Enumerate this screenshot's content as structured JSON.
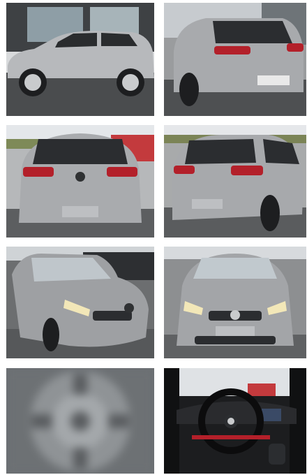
{
  "gallery": {
    "photos": [
      {
        "view": "side-left",
        "colors": {
          "body": "#b7b9bc",
          "bg": "#5c5f61",
          "ground": "#4a4c4e"
        }
      },
      {
        "view": "rear-three-quarter",
        "colors": {
          "body": "#a8aaad",
          "bg": "#8b8d8f",
          "ground": "#4e5052"
        }
      },
      {
        "view": "rear",
        "colors": {
          "body": "#a9abae",
          "bg": "#9aa07f",
          "ground": "#5c5e60"
        }
      },
      {
        "view": "rear-three-quarter-right",
        "colors": {
          "body": "#a7a9ac",
          "bg": "#8a8f74",
          "ground": "#5a5c5e"
        }
      },
      {
        "view": "front-three-quarter",
        "colors": {
          "body": "#9ea0a3",
          "bg": "#6c6e70",
          "ground": "#56585a"
        }
      },
      {
        "view": "front",
        "colors": {
          "body": "#a3a5a8",
          "bg": "#8d8f91",
          "ground": "#5f6163"
        }
      },
      {
        "view": "wheel-blurred",
        "colors": {
          "body": "#8f9396",
          "bg": "#6d7174",
          "ground": "#5a5d60"
        }
      },
      {
        "view": "interior-dashboard",
        "colors": {
          "body": "#1c1d1f",
          "bg": "#e8e8e8",
          "ground": "#101112"
        }
      }
    ],
    "accent_taillight": "#b3202a",
    "headlight": "#f2e7b8",
    "plate": "#e9e9e9"
  }
}
